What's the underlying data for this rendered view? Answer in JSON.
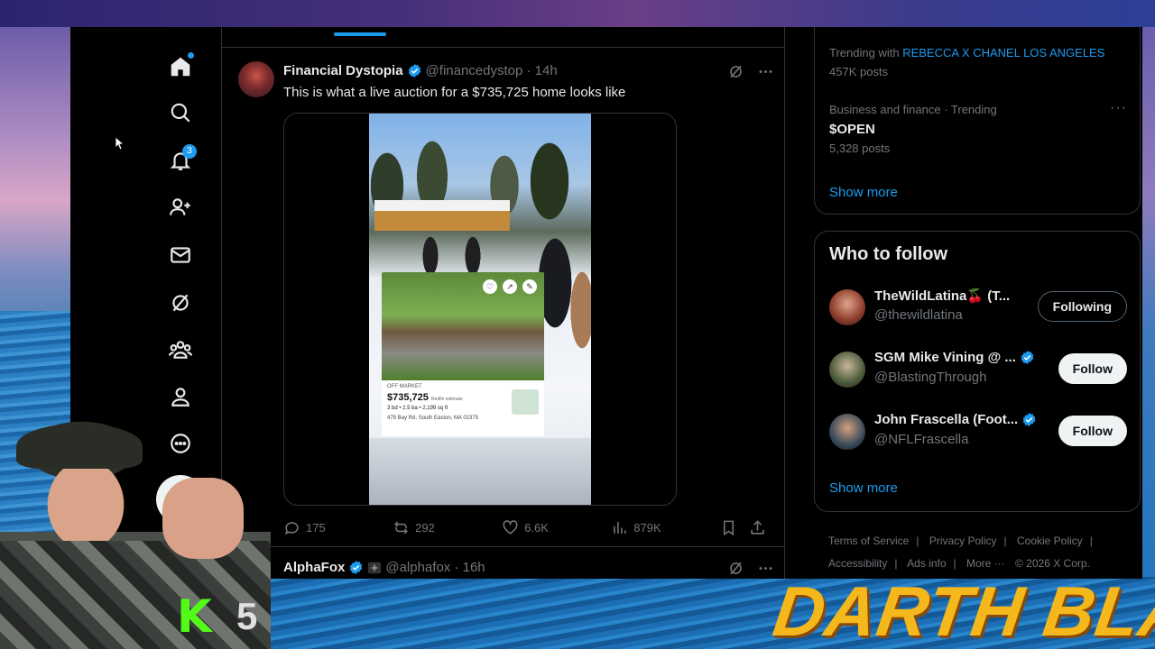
{
  "nav": {
    "items": [
      "home-icon",
      "search-icon",
      "notifications-icon",
      "follow-icon",
      "messages-icon",
      "grok-icon",
      "communities-icon",
      "profile-icon",
      "more-icon"
    ],
    "notification_count": "3"
  },
  "tweet1": {
    "name": "Financial Dystopia",
    "handle": "@financedystop · 14h",
    "text": "This is what a live auction for a $735,725 home looks like",
    "listing": {
      "status": "OFF MARKET",
      "price": "$735,725",
      "estimate_label": "Redfin estimate",
      "specs": "3 bd  •  2.5 ba  •  2,199 sq ft",
      "address": "479 Bay Rd, South Easton, MA 02375"
    },
    "replies": "175",
    "reposts": "292",
    "likes": "6.6K",
    "views": "879K"
  },
  "tweet2": {
    "name": "AlphaFox",
    "handle": "@alphafox · 16h"
  },
  "trends": {
    "item1": {
      "meta_prefix": "Trending with",
      "meta_link": "REBECCA X CHANEL LOS ANGELES",
      "count": "457K posts"
    },
    "item2": {
      "meta": "Business and finance · Trending",
      "title": "$OPEN",
      "count": "5,328 posts"
    },
    "show_more": "Show more"
  },
  "who_to_follow": {
    "title": "Who to follow",
    "users": [
      {
        "name": "TheWildLatina🍒 (T...",
        "handle": "@thewildlatina",
        "button": "Following"
      },
      {
        "name": "SGM Mike Vining @ ...",
        "handle": "@BlastingThrough",
        "button": "Follow"
      },
      {
        "name": "John Frascella (Foot...",
        "handle": "@NFLFrascella",
        "button": "Follow"
      }
    ],
    "show_more": "Show more"
  },
  "footer": {
    "links": [
      "Terms of Service",
      "Privacy Policy",
      "Cookie Policy",
      "Accessibility",
      "Ads info",
      "More ···",
      "© 2026 X Corp."
    ]
  },
  "overlay": {
    "kick_letter": "K",
    "kick_number": "5",
    "brand": "DARTH BLAZE"
  },
  "colors": {
    "accent": "#1d9bf0",
    "background": "#000000",
    "muted": "#71767b",
    "brand_yellow": "#f5b81c",
    "kick_green": "#53fc18"
  }
}
